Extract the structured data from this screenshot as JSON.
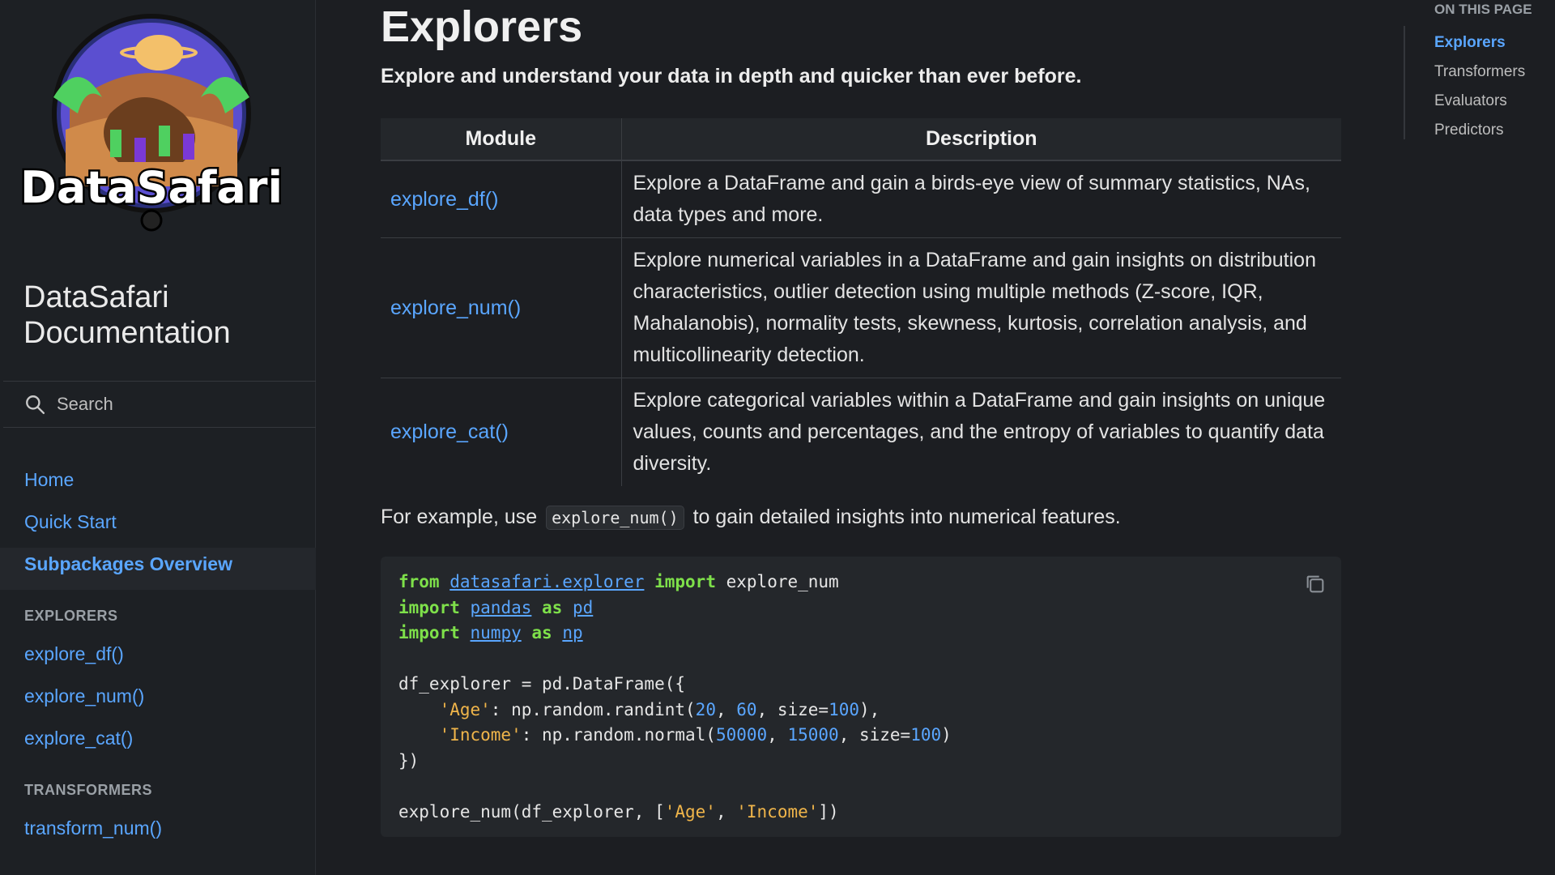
{
  "sidebar": {
    "logo_text": "DataSafari",
    "site_title": "DataSafari Documentation",
    "search_placeholder": "Search",
    "nav": [
      {
        "label": "Home"
      },
      {
        "label": "Quick Start"
      },
      {
        "label": "Subpackages Overview",
        "active": true
      }
    ],
    "sections": [
      {
        "title": "EXPLORERS",
        "items": [
          "explore_df()",
          "explore_num()",
          "explore_cat()"
        ]
      },
      {
        "title": "TRANSFORMERS",
        "items": [
          "transform_num()"
        ]
      }
    ]
  },
  "main": {
    "title": "Explorers",
    "lead": "Explore and understand your data in depth and quicker than ever before.",
    "table": {
      "headers": [
        "Module",
        "Description"
      ],
      "rows": [
        {
          "module": "explore_df()",
          "description": "Explore a DataFrame and gain a birds-eye view of summary statistics, NAs, data types and more."
        },
        {
          "module": "explore_num()",
          "description": "Explore numerical variables in a DataFrame and gain insights on distribution characteristics, outlier detection using multiple methods (Z-score, IQR, Mahalanobis), normality tests, skewness, kurtosis, correlation analysis, and multicollinearity detection."
        },
        {
          "module": "explore_cat()",
          "description": "Explore categorical variables within a DataFrame and gain insights on unique values, counts and percentages, and the entropy of variables to quantify data diversity."
        }
      ]
    },
    "example": {
      "before": "For example, use",
      "code": "explore_num()",
      "after": "to gain detailed insights into numerical features."
    },
    "code_block": {
      "l1": {
        "from": "from",
        "module": "datasafari.explorer",
        "import": "import",
        "name": "explore_num"
      },
      "l2": {
        "import": "import",
        "module": "pandas",
        "as": "as",
        "alias": "pd"
      },
      "l3": {
        "import": "import",
        "module": "numpy",
        "as": "as",
        "alias": "np"
      },
      "l5": "df_explorer = pd.DataFrame({",
      "l6": {
        "indent": "    ",
        "key": "'Age'",
        "call": ": np.random.randint(",
        "a": "20",
        "sep1": ", ",
        "b": "60",
        "sep2": ", size=",
        "c": "100",
        "end": "),"
      },
      "l7": {
        "indent": "    ",
        "key": "'Income'",
        "call": ": np.random.normal(",
        "a": "50000",
        "sep1": ", ",
        "b": "15000",
        "sep2": ", size=",
        "c": "100",
        "end": ")"
      },
      "l8": "})",
      "l10": {
        "pre": "explore_num(df_explorer, [",
        "s1": "'Age'",
        "sep": ", ",
        "s2": "'Income'",
        "end": "])"
      }
    }
  },
  "toc": {
    "heading": "ON THIS PAGE",
    "items": [
      "Explorers",
      "Transformers",
      "Evaluators",
      "Predictors"
    ],
    "active_index": 0
  },
  "colors": {
    "background": "#1c1e22",
    "sidebar": "#1d2024",
    "link": "#5aa6ff",
    "keyword": "#7ee04a",
    "string": "#f0b54a"
  },
  "icons": [
    "search-icon",
    "copy-icon",
    "datasafari-logo"
  ]
}
